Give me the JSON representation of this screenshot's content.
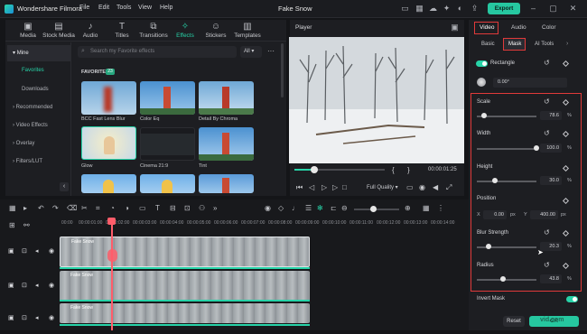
{
  "app": {
    "name": "Wondershare Filmora",
    "project_title": "Fake Snow"
  },
  "menu": [
    "File",
    "Edit",
    "Tools",
    "View",
    "Help"
  ],
  "export_label": "Export",
  "media_tabs": [
    {
      "label": "Media",
      "icon": "media-icon"
    },
    {
      "label": "Stock Media",
      "icon": "stock-media-icon"
    },
    {
      "label": "Audio",
      "icon": "audio-icon"
    },
    {
      "label": "Titles",
      "icon": "titles-icon"
    },
    {
      "label": "Transitions",
      "icon": "transitions-icon"
    },
    {
      "label": "Effects",
      "icon": "effects-icon",
      "active": true
    },
    {
      "label": "Stickers",
      "icon": "stickers-icon"
    },
    {
      "label": "Templates",
      "icon": "templates-icon"
    }
  ],
  "sidebar": {
    "items": [
      "Mine",
      "Favorites",
      "Downloads",
      "Recommended",
      "Video Effects",
      "Overlay",
      "Filters/LUT"
    ]
  },
  "search": {
    "placeholder": "Search my Favorite effects",
    "filter": "All"
  },
  "favorites": {
    "title": "FAVORITES",
    "count": "23"
  },
  "effects": [
    {
      "label": "BCC Fast Lens Blur"
    },
    {
      "label": "Color Eq"
    },
    {
      "label": "Detail By Chroma"
    },
    {
      "label": "Glow"
    },
    {
      "label": "Cinema 21:9"
    },
    {
      "label": "Tint"
    },
    {
      "label": ""
    },
    {
      "label": ""
    },
    {
      "label": ""
    }
  ],
  "player": {
    "label": "Player",
    "timecode": "00:00:01:25",
    "quality": "Full Quality"
  },
  "right_panel": {
    "tabs": [
      "Video",
      "Audio",
      "Color"
    ],
    "subtabs": [
      "Basic",
      "Mask",
      "AI Tools"
    ],
    "mask_shape": "Rectangle",
    "rotation": "0.00°",
    "params": [
      {
        "name": "Scale",
        "value": "78.6",
        "unit": "%",
        "level": 0.12
      },
      {
        "name": "Width",
        "value": "100.0",
        "unit": "%",
        "level": 1.0
      },
      {
        "name": "Height",
        "value": "30.0",
        "unit": "%",
        "level": 0.3
      },
      {
        "name": "Position",
        "x_label": "X",
        "x": "0.00",
        "x_unit": "px",
        "y_label": "Y",
        "y": "400.00",
        "y_unit": "px"
      },
      {
        "name": "Blur Strength",
        "value": "20.3",
        "unit": "%",
        "level": 0.2
      },
      {
        "name": "Radius",
        "value": "43.8",
        "unit": "%",
        "level": 0.44
      }
    ],
    "invert_mask": "Invert Mask",
    "reset": "Reset",
    "ok": "OK"
  },
  "timeline": {
    "ruler": [
      "00:00",
      "00:00:01:00",
      "00:00:02:00",
      "00:00:03:00",
      "00:00:04:00",
      "00:00:05:00",
      "00:00:06:00",
      "00:00:07:00",
      "00:00:08:00",
      "00:00:09:00",
      "00:00:10:00",
      "00:00:11:00",
      "00:00:12:00",
      "00:00:13:00",
      "00:00:14:00"
    ],
    "tracks": [
      {
        "label": "Fake Snow"
      },
      {
        "label": "Fake Snow"
      },
      {
        "label": "Fake Snow"
      }
    ]
  },
  "watermark": "vid.com",
  "colors": {
    "accent": "#27d3a8",
    "highlight": "#e03a3a"
  }
}
